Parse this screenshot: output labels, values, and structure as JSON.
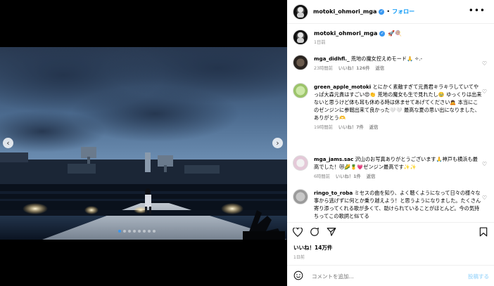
{
  "header": {
    "username": "motoki_ohmori_mga",
    "follow_label": "フォロー",
    "more_label": "•••"
  },
  "caption": {
    "username": "motoki_ohmori_mga",
    "text": "🚀🍭",
    "date": "1日前"
  },
  "comments": [
    {
      "username": "mga_didhfl._",
      "text": "荒地の魔女控えめモード🙏 ✧.-",
      "time": "23時間前",
      "likes": "いいね！126件",
      "reply": "返信"
    },
    {
      "username": "green_apple_motoki",
      "text": "とにかく素敵すぎて元貴君キラキラしていてやっぱ大森元貴はすごい😍👏 荒地の魔女も生で見れたし🥹 ゆっくりは出来ないと思うけど体も耳も休める時は休ませてあげてください🙇 本当にこのゼンジンに参戦出来て良かった🤍🤍 最高な夏の思い出になりました、ありがとう🫶",
      "time": "19時間前",
      "likes": "いいね！7件",
      "reply": "返信"
    },
    {
      "username": "mga_jams.sac",
      "text": "沢山のお写真ありがとうございます🙏神戸も横浜も最高でした！😻🌽🍍💗ゼンジン最高です✨✨",
      "time": "6時間前",
      "likes": "いいね！1件",
      "reply": "返信"
    },
    {
      "username": "ringo_to_roba",
      "text": "ミセスの曲を知り、よく聴くようになって日々の様々な事から逃げずに何とか乗り越えよう！と思うようになりました。たくさん寄り添ってくれる歌が多くて、助けられていることがほとんど。今の気持ちってこの歌詞と似てる",
      "time": "",
      "likes": "",
      "reply": ""
    }
  ],
  "likes_total": "いいね！14万件",
  "posted_ago": "1日前",
  "comment_input": {
    "placeholder": "コメントを追加...",
    "post_label": "投稿する"
  },
  "icons": {
    "like": "heart-icon",
    "comment": "comment-icon",
    "share": "share-icon",
    "save": "bookmark-icon",
    "emoji": "emoji-icon",
    "prev": "chevron-left-icon",
    "next": "chevron-right-icon"
  },
  "carousel": {
    "slides": 8,
    "active_index": 0
  },
  "colors": {
    "accent": "#0095f6",
    "verified": "#3897f0"
  }
}
